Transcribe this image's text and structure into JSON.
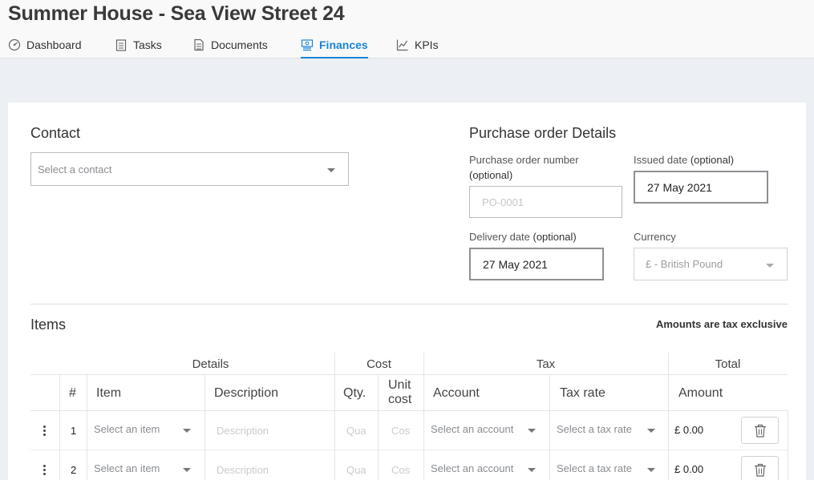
{
  "header": {
    "title": "Summer House - Sea View Street 24",
    "tabs": [
      {
        "label": "Dashboard",
        "icon": "dashboard-icon"
      },
      {
        "label": "Tasks",
        "icon": "tasks-icon"
      },
      {
        "label": "Documents",
        "icon": "documents-icon"
      },
      {
        "label": "Finances",
        "icon": "finances-icon",
        "active": true
      },
      {
        "label": "KPIs",
        "icon": "kpis-icon"
      }
    ]
  },
  "contact": {
    "heading": "Contact",
    "placeholder": "Select a contact"
  },
  "po_details": {
    "heading": "Purchase order Details",
    "po_number_label": "Purchase order number",
    "po_number_optional": "(optional)",
    "po_number_placeholder": "PO-0001",
    "issued_label": "Issued date",
    "issued_optional": "(optional)",
    "issued_value": "27 May 2021",
    "delivery_label": "Delivery date",
    "delivery_optional": "(optional)",
    "delivery_value": "27 May 2021",
    "currency_label": "Currency",
    "currency_value": "£ - British Pound"
  },
  "items": {
    "heading": "Items",
    "tax_note": "Amounts are tax exclusive",
    "groups": {
      "details": "Details",
      "cost": "Cost",
      "tax": "Tax",
      "total": "Total"
    },
    "columns": {
      "num": "#",
      "item": "Item",
      "description": "Description",
      "qty": "Qty.",
      "unit_cost_1": "Unit",
      "unit_cost_2": "cost",
      "account": "Account",
      "tax_rate": "Tax rate",
      "amount": "Amount"
    },
    "rows": [
      {
        "num": "1",
        "item_placeholder": "Select an item",
        "description_placeholder": "Description",
        "qty_placeholder": "Qua",
        "cost_placeholder": "Cost",
        "account_placeholder": "Select an account",
        "tax_placeholder": "Select a tax rate",
        "amount": "£ 0.00"
      },
      {
        "num": "2",
        "item_placeholder": "Select an item",
        "description_placeholder": "Description",
        "qty_placeholder": "Qua",
        "cost_placeholder": "Cost",
        "account_placeholder": "Select an account",
        "tax_placeholder": "Select a tax rate",
        "amount": "£ 0.00"
      }
    ]
  },
  "colors": {
    "accent": "#1a84d8",
    "page_bg": "#eceff3",
    "topbar_bg": "#f9f9f9"
  }
}
